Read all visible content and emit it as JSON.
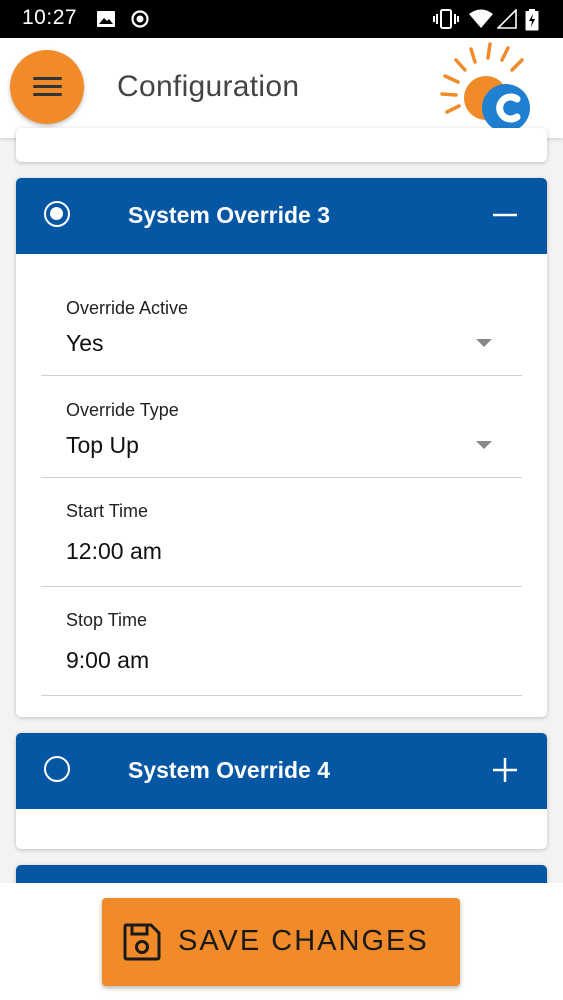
{
  "status_bar": {
    "time": "10:27"
  },
  "app_bar": {
    "title": "Configuration"
  },
  "cards": [
    {
      "title": "System Override 3",
      "selected": true,
      "expanded": true,
      "fields": [
        {
          "label": "Override Active",
          "value": "Yes"
        },
        {
          "label": "Override Type",
          "value": "Top Up"
        },
        {
          "label": "Start Time",
          "value": "12:00 am"
        },
        {
          "label": "Stop Time",
          "value": "9:00 am"
        }
      ]
    },
    {
      "title": "System Override 4",
      "selected": false,
      "expanded": false
    }
  ],
  "save": {
    "label": "SAVE CHANGES"
  },
  "colors": {
    "accent_orange": "#f18a28",
    "header_blue": "#0556a3",
    "logo_blue": "#1f7fd0"
  }
}
